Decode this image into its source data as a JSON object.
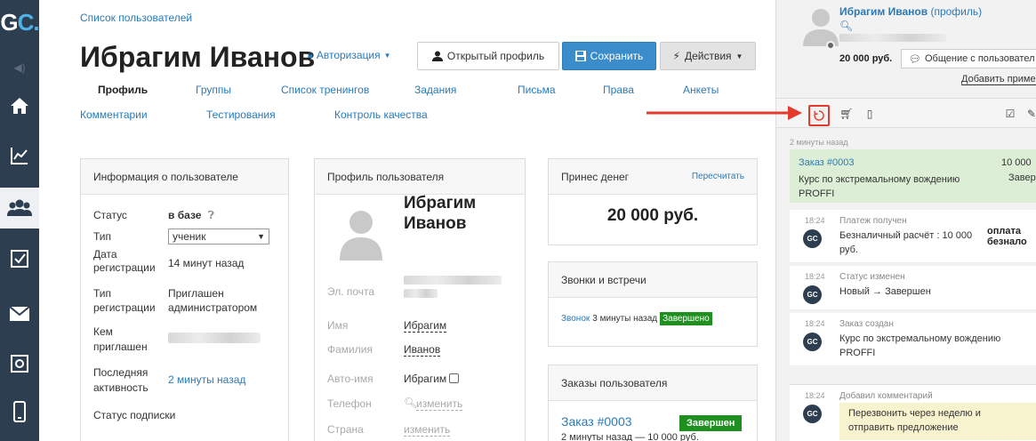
{
  "logo": {
    "g": "G",
    "c": "C."
  },
  "main": {
    "breadcrumb": "Список пользователей",
    "title": "Ибрагим Иванов",
    "auth_label": "Авторизация",
    "open_profile_label": "Открытый профиль",
    "save_label": "Сохранить",
    "actions_label": "Действия",
    "tabs": [
      "Профиль",
      "Группы",
      "Список тренингов",
      "Задания",
      "Письма",
      "Права",
      "Анкеты",
      "Комментарии",
      "Тестирования",
      "Контроль качества"
    ]
  },
  "info_panel": {
    "title": "Информация о пользователе",
    "status_label": "Статус",
    "status_value": "в базе",
    "type_label": "Тип",
    "type_value": "ученик",
    "reg_date_label_1": "Дата",
    "reg_date_label_2": "регистрации",
    "reg_date_value": "14 минут назад",
    "reg_type_label_1": "Тип",
    "reg_type_label_2": "регистрации",
    "reg_type_value_1": "Приглашен",
    "reg_type_value_2": "администратором",
    "invited_label_1": "Кем",
    "invited_label_2": "приглашен",
    "last_activity_label_1": "Последняя",
    "last_activity_label_2": "активность",
    "last_activity_value": "2 минуты назад",
    "subscription_label": "Статус подписки"
  },
  "profile_panel": {
    "title": "Профиль пользователя",
    "name_line_1": "Ибрагим",
    "name_line_2": "Иванов",
    "email_label": "Эл. почта",
    "first_name_label": "Имя",
    "first_name_value": "Ибрагим",
    "last_name_label": "Фамилия",
    "last_name_value": "Иванов",
    "auto_name_label": "Авто-имя",
    "auto_name_value": "Ибрагим",
    "phone_label": "Телефон",
    "phone_value": "изменить",
    "country_label": "Страна",
    "country_value": "изменить"
  },
  "money_panel": {
    "title": "Принес денег",
    "recalc_label": "Пересчитать",
    "value": "20 000 руб."
  },
  "calls_panel": {
    "title": "Звонки и встречи",
    "call_link": "Звонок",
    "call_time": "3 минуты назад",
    "call_status": "Завершено"
  },
  "orders_panel": {
    "title": "Заказы пользователя",
    "order_link": "Заказ #0003",
    "order_status": "Завершен",
    "order_sub": "2 минуты назад — 10 000 руб."
  },
  "right_panel": {
    "name": "Ибрагим Иванов",
    "profile_suffix": "(профиль)",
    "money": "20 000 руб.",
    "chat_label": "Общение с пользовател",
    "add_label": "Добавить приме",
    "time_ago": "2 минуты назад",
    "order": {
      "link": "Заказ #0003",
      "amount": "10 000",
      "desc": "Курс по экстремальному вождению PROFFI",
      "status": "Завер"
    },
    "events": [
      {
        "time": "18:24",
        "icon": "GC",
        "title": "Платеж получен",
        "body": "Безналичный расчёт : 10 000 руб.",
        "right_1": "оплата",
        "right_2": "безнало"
      },
      {
        "time": "18:24",
        "icon": "GC",
        "title": "Статус изменен",
        "body": "Новый → Завершен"
      },
      {
        "time": "18:24",
        "icon": "GC",
        "title": "Заказ создан",
        "body": "Курс по экстремальному вождению PROFFI"
      },
      {
        "time": "18:24",
        "icon": "GC",
        "title": "Добавил комментарий",
        "body": "Перезвонить через неделю и отправить предложение"
      }
    ]
  },
  "colors": {
    "sidebar": "#2c3e50",
    "link": "#2a7ab8",
    "save": "#3b8ccb",
    "success": "#1f8f1f",
    "annotation": "#e23b2e",
    "order_bg": "#dcefd6",
    "comment_bg": "#f7f3cf"
  },
  "icons": [
    "logo",
    "speaker-icon",
    "home-icon",
    "chart-icon",
    "users-icon",
    "checkbox-icon",
    "mail-icon",
    "safe-icon",
    "mobile-icon",
    "lock-icon",
    "user-icon",
    "save-icon",
    "bolt-icon",
    "question-icon",
    "search-icon",
    "chat-icon",
    "history-icon",
    "cart-icon",
    "tablet-icon",
    "check-square-icon",
    "pencil-icon"
  ]
}
